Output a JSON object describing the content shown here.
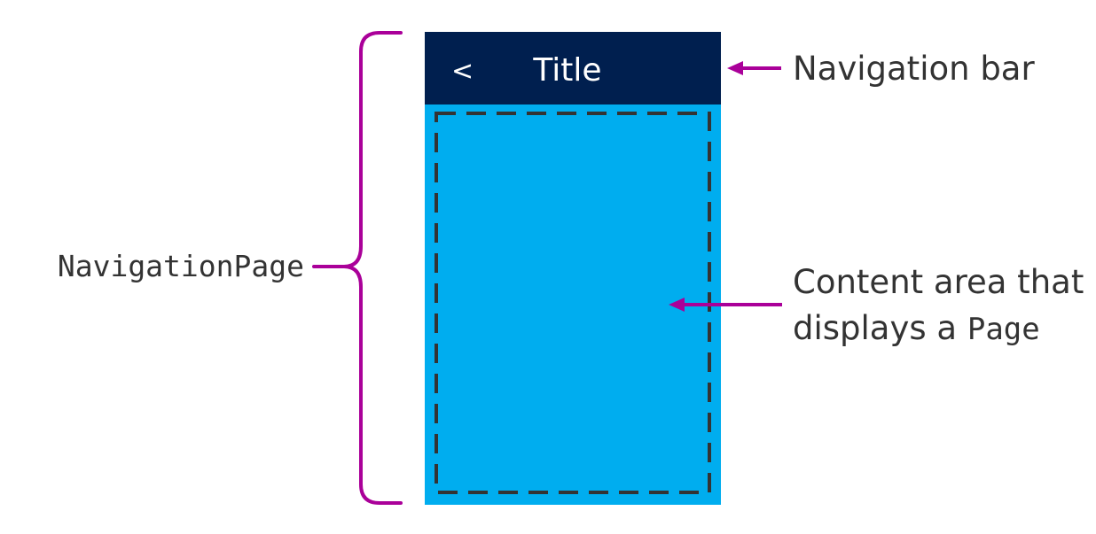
{
  "labels": {
    "container": "NavigationPage",
    "nav_bar_label": "Navigation bar",
    "content_label_line1": "Content area that",
    "content_label_line2_prefix": "displays a ",
    "content_label_line2_code": "Page"
  },
  "phone": {
    "back_glyph": "<",
    "title": "Title"
  },
  "colors": {
    "nav_bar": "#001f4f",
    "content_area": "#00adef",
    "annotation": "#aa0099",
    "dashed_border": "#333333",
    "text": "#333333",
    "nav_text": "#ffffff"
  }
}
